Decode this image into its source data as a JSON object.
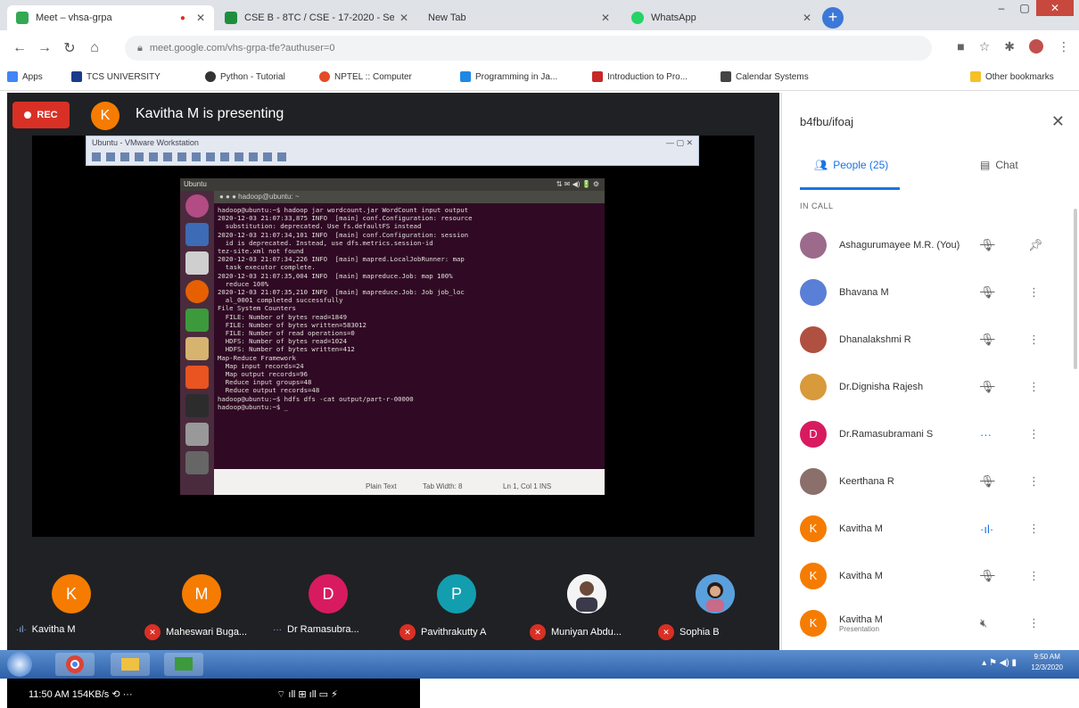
{
  "browser": {
    "tabs": [
      {
        "title": "Meet – vhsa-grpa",
        "active": true
      },
      {
        "title": "CSE B - 8TC / CSE - 17-2020 - Ses",
        "active": false
      },
      {
        "title": "New Tab",
        "active": false
      },
      {
        "title": "WhatsApp",
        "active": false
      }
    ],
    "url": "meet.google.com/vhs-grpa-tfe?authuser=0",
    "bookmarks": [
      "Apps",
      "TCS UNIVERSITY",
      "Python - Tutorial",
      "NPTEL :: Computer",
      "Programming in Ja...",
      "Introduction to Pro...",
      "Calendar Systems",
      "Other bookmarks"
    ]
  },
  "meet": {
    "rec_label": "REC",
    "presenter_initial": "K",
    "presenter_title": "Kavitha M is presenting",
    "shared_window": {
      "title": "Ubuntu - VMware Workstation",
      "terminal_title": "hadoop@ubuntu: ~",
      "terminal_lines": [
        "hadoop@ubuntu:~$ hadoop jar wordcount.jar WordCount input output",
        "2020-12-03 21:07:33,875 INFO  [main] conf.Configuration: resource",
        "  substitution: deprecated. Use fs.defaultFS instead",
        "2020-12-03 21:07:34,101 INFO  [main] conf.Configuration: session",
        "  id is deprecated. Instead, use dfs.metrics.session-id",
        "tez-site.xml not found",
        "2020-12-03 21:07:34,226 INFO  [main] mapred.LocalJobRunner: map",
        "  task executor complete.",
        "2020-12-03 21:07:35,004 INFO  [main] mapreduce.Job: map 100% ",
        "  reduce 100%",
        "2020-12-03 21:07:35,210 INFO  [main] mapreduce.Job: Job job_loc",
        "  al_0001 completed successfully",
        "File System Counters",
        "  FILE: Number of bytes read=1849",
        "  FILE: Number of bytes written=583012",
        "  FILE: Number of read operations=0",
        "  HDFS: Number of bytes read=1024",
        "  HDFS: Number of bytes written=412",
        "Map-Reduce Framework",
        "  Map input records=24",
        "  Map output records=96",
        "  Reduce input groups=48",
        "  Reduce output records=48",
        "hadoop@ubuntu:~$ hdfs dfs -cat output/part-r-00000",
        "hadoop@ubuntu:~$ _"
      ],
      "status_left": "Plain Text",
      "status_mid": "Tab Width: 8",
      "status_right": "Ln 1, Col 1   INS"
    },
    "participants_strip": [
      {
        "initial": "K",
        "name": "Kavitha M",
        "color": "#f57c00",
        "muted": false
      },
      {
        "initial": "M",
        "name": "Maheswari Buga...",
        "color": "#f57c00",
        "muted": true
      },
      {
        "initial": "D",
        "name": "Dr Ramasubra...",
        "color": "#d81b60",
        "muted": false
      },
      {
        "initial": "P",
        "name": "Pavithrakutty A",
        "color": "#129eaf",
        "muted": true
      },
      {
        "initial": "",
        "name": "Muniyan Abdu...",
        "color": "#ffffff",
        "muted": true
      },
      {
        "initial": "",
        "name": "Sophia B",
        "color": "#3b8bd0",
        "muted": true
      }
    ]
  },
  "panel": {
    "meeting_code": "b4fbu/ifoaj",
    "tab_people": "People (25)",
    "tab_chat": "Chat",
    "section_label": "IN CALL",
    "people": [
      {
        "initial": "",
        "name": "Ashagurumayee M.R. (You)",
        "sub": "",
        "color": "#9c6b8c",
        "status": "muted",
        "action": "pin"
      },
      {
        "initial": "",
        "name": "Bhavana M",
        "sub": "",
        "color": "#5a7fd6",
        "status": "muted",
        "action": "more"
      },
      {
        "initial": "",
        "name": "Dhanalakshmi R",
        "sub": "",
        "color": "#b05040",
        "status": "muted",
        "action": "more"
      },
      {
        "initial": "",
        "name": "Dr.Dignisha Rajesh",
        "sub": "",
        "color": "#d89a3a",
        "status": "muted",
        "action": "more"
      },
      {
        "initial": "D",
        "name": "Dr.Ramasubramani S",
        "sub": "",
        "color": "#d81b60",
        "status": "speaking",
        "action": "more"
      },
      {
        "initial": "",
        "name": "Keerthana R",
        "sub": "",
        "color": "#8a6f6a",
        "status": "muted",
        "action": "more"
      },
      {
        "initial": "K",
        "name": "Kavitha M",
        "sub": "",
        "color": "#f57c00",
        "status": "talking",
        "action": "more"
      },
      {
        "initial": "K",
        "name": "Kavitha M",
        "sub": "",
        "color": "#f57c00",
        "status": "muted",
        "action": "more"
      },
      {
        "initial": "K",
        "name": "Kavitha M",
        "sub": "Presentation",
        "color": "#f57c00",
        "status": "speaker-off",
        "action": "more"
      }
    ]
  },
  "taskbar": {
    "time": "9:50 AM",
    "date": "12/3/2020"
  },
  "phone_status": {
    "left": "11:50 AM  154KB/s ⟲ ···",
    "right": "⌔ ıll ⊞ ıll ▭ ⚡"
  }
}
